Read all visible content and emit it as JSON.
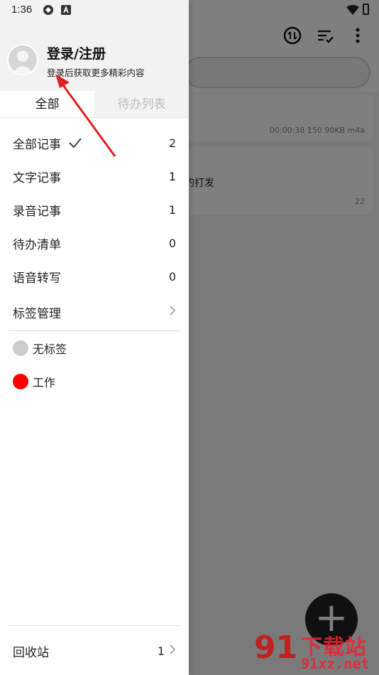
{
  "status_bar": {
    "time": "1:36"
  },
  "background": {
    "card1_meta": "00:00:38 150.90KB m4a",
    "card2_snippet": "的打发",
    "card2_meta": "22"
  },
  "profile": {
    "title": "登录/注册",
    "subtitle": "登录后获取更多精彩内容"
  },
  "tabs": [
    {
      "label": "全部",
      "active": true
    },
    {
      "label": "待办列表",
      "active": false
    }
  ],
  "menu": {
    "all": {
      "label": "全部记事",
      "count": "2"
    },
    "text": {
      "label": "文字记事",
      "count": "1"
    },
    "audio": {
      "label": "录音记事",
      "count": "1"
    },
    "todo": {
      "label": "待办清单",
      "count": "0"
    },
    "transcribe": {
      "label": "语音转写",
      "count": "0"
    },
    "tags": {
      "label": "标签管理"
    }
  },
  "tag_list": [
    {
      "label": "无标签",
      "color": "#cccccc"
    },
    {
      "label": "工作",
      "color": "#ff0000"
    }
  ],
  "footer": {
    "label": "回收站",
    "count": "1"
  },
  "watermark": {
    "big": "91",
    "cn": "下载站",
    "url": "91xz.net"
  },
  "colors": {
    "annotation": "#e02020",
    "fab": "#202020"
  }
}
